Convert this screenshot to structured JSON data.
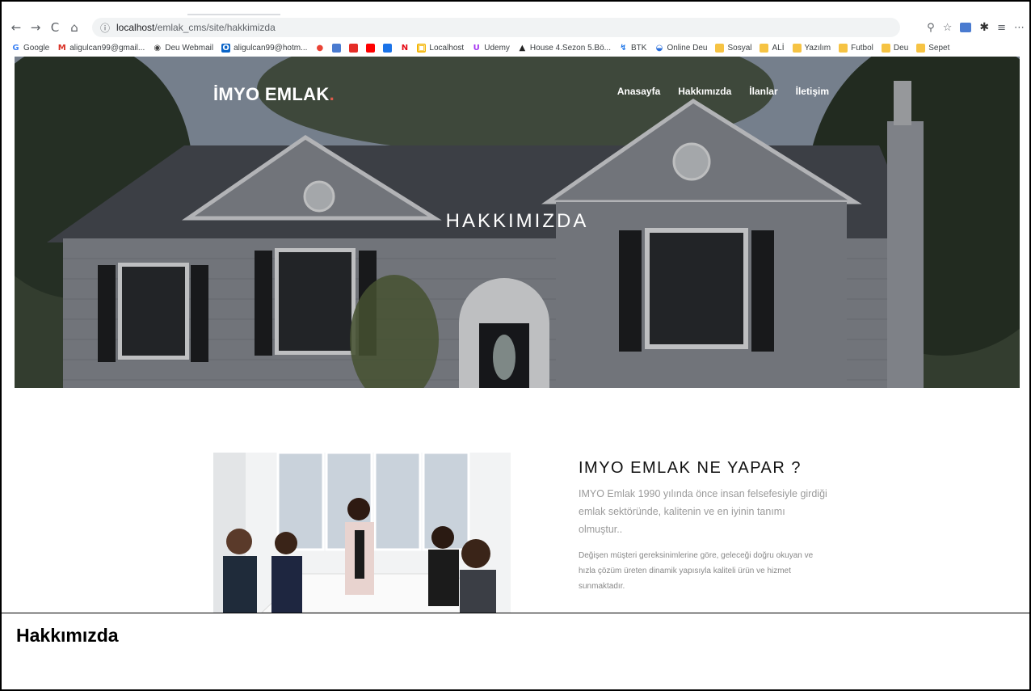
{
  "browser": {
    "nav_back": "←",
    "nav_forward": "→",
    "nav_reload": "C",
    "nav_home": "⌂",
    "url_host": "localhost",
    "url_path": "/emlak_cms/site/hakkimizda",
    "right_icons": [
      "zoom-icon",
      "star-icon",
      "extension-icon",
      "puzzle-icon",
      "reading-list-icon",
      "menu-icon"
    ],
    "bookmarks": [
      {
        "label": "Google",
        "icon": "google-icon"
      },
      {
        "label": "aligulcan99@gmail...",
        "icon": "gmail-icon"
      },
      {
        "label": "Deu Webmail",
        "icon": "globe-icon"
      },
      {
        "label": "aligulcan99@hotm...",
        "icon": "outlook-icon"
      },
      {
        "label": "",
        "icon": "maps-icon"
      },
      {
        "label": "",
        "icon": "extension-icon"
      },
      {
        "label": "",
        "icon": "y-icon"
      },
      {
        "label": "",
        "icon": "youtube-icon"
      },
      {
        "label": "",
        "icon": "play-icon"
      },
      {
        "label": "",
        "icon": "netflix-icon"
      },
      {
        "label": "Localhost",
        "icon": "localhost-icon"
      },
      {
        "label": "Udemy",
        "icon": "udemy-icon"
      },
      {
        "label": "House 4.Sezon 5.Bö...",
        "icon": "house-icon"
      },
      {
        "label": "BTK",
        "icon": "btk-icon"
      },
      {
        "label": "Online Deu",
        "icon": "deu-icon"
      },
      {
        "label": "Sosyal",
        "icon": "folder-icon"
      },
      {
        "label": "ALİ",
        "icon": "folder-icon"
      },
      {
        "label": "Yazılım",
        "icon": "folder-icon"
      },
      {
        "label": "Futbol",
        "icon": "folder-icon"
      },
      {
        "label": "Deu",
        "icon": "folder-icon"
      },
      {
        "label": "Sepet",
        "icon": "folder-icon"
      }
    ]
  },
  "site": {
    "brand": "İMYO EMLAK",
    "brand_dot": ".",
    "nav": [
      "Anasayfa",
      "Hakkımızda",
      "İlanlar",
      "İletişim"
    ],
    "hero_title": "HAKKIMIZDA"
  },
  "about": {
    "heading": "IMYO EMLAK NE YAPAR ?",
    "lead": "IMYO Emlak 1990 yılında önce insan felsefesiyle girdiği emlak sektöründe, kalitenin ve en iyinin tanımı olmuştur..",
    "body": "Değişen müşteri gereksinimlerine göre, geleceği doğru okuyan ve hızla çözüm üreten dinamik yapısıyla kaliteli ürün ve hizmet sunmaktadır."
  },
  "caption": "Hakkımızda",
  "colors": {
    "brand_dot": "#e05a4a",
    "hero_overlay": "rgba(0,0,0,0.18)",
    "heading": "#111111",
    "lead_text": "#9a9a9a"
  }
}
